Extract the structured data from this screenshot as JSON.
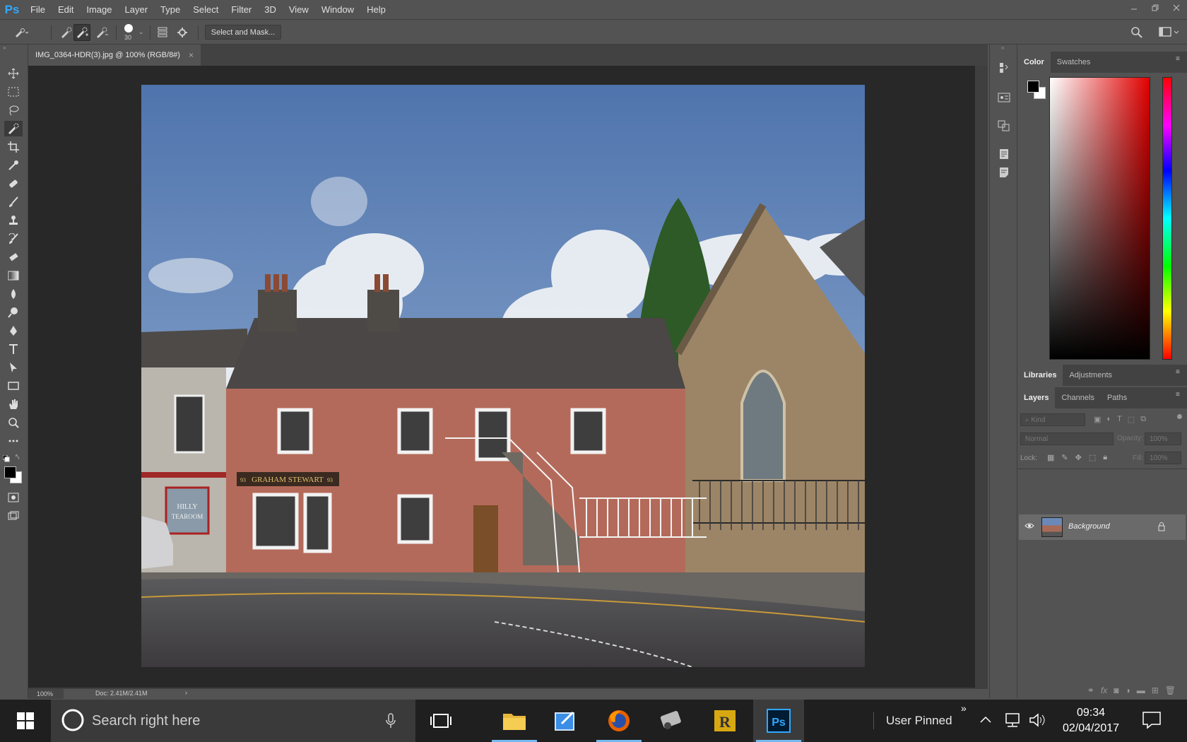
{
  "app": {
    "logo_text": "Ps"
  },
  "menu": {
    "items": [
      "File",
      "Edit",
      "Image",
      "Layer",
      "Type",
      "Select",
      "Filter",
      "3D",
      "View",
      "Window",
      "Help"
    ]
  },
  "window_controls": [
    "minimize",
    "restore",
    "close"
  ],
  "options_bar": {
    "brush_size": "30",
    "select_and_mask_label": "Select and Mask..."
  },
  "document": {
    "tab_title": "IMG_0364-HDR(3).jpg @ 100% (RGB/8#)",
    "close_glyph": "×",
    "zoom": "100%",
    "doc_info": "Doc: 2.41M/2.41M",
    "status_arrow": "›",
    "shop_sign": "GRAHAM STEWART",
    "shop_sign_number": "93",
    "tearoom_sign_line1": "HILLY",
    "tearoom_sign_line2": "TEAROOM"
  },
  "tools": [
    "move-tool",
    "marquee-tool",
    "lasso-tool",
    "quick-selection-tool",
    "crop-tool",
    "eyedropper-tool",
    "healing-brush-tool",
    "brush-tool",
    "clone-stamp-tool",
    "history-brush-tool",
    "eraser-tool",
    "gradient-tool",
    "blur-tool",
    "dodge-tool",
    "pen-tool",
    "type-tool",
    "path-selection-tool",
    "rectangle-tool",
    "hand-tool",
    "zoom-tool",
    "more-tools-icon"
  ],
  "colors": {
    "foreground": "#000000",
    "background": "#ffffff",
    "hue_selected": "#ff0000"
  },
  "panels": {
    "color_tabs": [
      "Color",
      "Swatches"
    ],
    "library_tabs": [
      "Libraries",
      "Adjustments"
    ],
    "layer_tabs": [
      "Layers",
      "Channels",
      "Paths"
    ],
    "kind_filter": "Kind",
    "blend_mode": "Normal",
    "opacity_label": "Opacity:",
    "opacity_value": "100%",
    "lock_label": "Lock:",
    "fill_label": "Fill:",
    "fill_value": "100%",
    "layers": [
      {
        "name": "Background",
        "visible": true,
        "locked": true
      }
    ]
  },
  "taskbar": {
    "search_placeholder": "Search right here",
    "user_pinned": "User Pinned",
    "time": "09:34",
    "date": "02/04/2017",
    "apps": [
      "file-explorer",
      "paint-app",
      "firefox",
      "photo-app",
      "r-app",
      "photoshop"
    ]
  }
}
